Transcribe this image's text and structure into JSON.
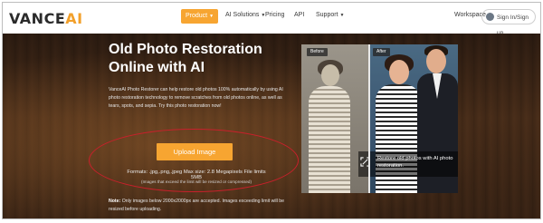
{
  "header": {
    "logo_main": "VANCE",
    "logo_accent": "AI",
    "nav": [
      {
        "label": "Product",
        "active": true
      },
      {
        "label": "AI Solutions",
        "dropdown": true
      },
      {
        "label": "Pricing"
      },
      {
        "label": "API"
      },
      {
        "label": "Support",
        "dropdown": true
      }
    ],
    "workspace": "Workspace",
    "signin": "Sign In/Sign up"
  },
  "hero": {
    "title_line1": "Old Photo Restoration",
    "title_line2": "Online with AI",
    "description": "VanceAI Photo Restorer can help restore old photos 100% automatically by using AI photo restoration technology to remove scratches from old photos online, as well as tears, spots, and sepia. Try this photo restoration now!",
    "upload_button": "Upload Image",
    "formats": "Formats: .jpg,.png,.jpeg Max size: 2.8 Megapixels File limits 5MB",
    "formats_note": "(Images that exceed the limit will be resized or compressed)",
    "note_label": "Note:",
    "note_text": " Only images below 2000x2000px are accepted. Images exceeding limit will be resized before uploading."
  },
  "preview": {
    "before_label": "Before",
    "after_label": "After",
    "caption": "Restore old photos with AI photo restoration."
  },
  "colors": {
    "accent": "#f7a531",
    "annotation": "#c8202b"
  }
}
